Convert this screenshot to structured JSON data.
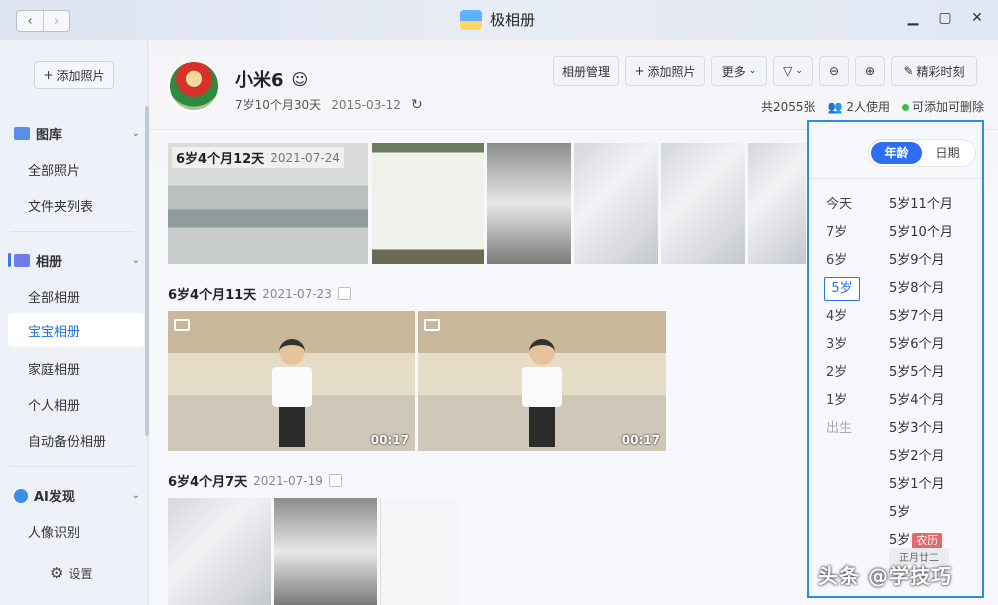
{
  "titlebar": {
    "app_name": "极相册",
    "back_icon": "chevron-left-icon",
    "forward_icon": "chevron-right-icon"
  },
  "sidebar": {
    "add_photo": "添加照片",
    "sections": [
      {
        "title": "图库",
        "items": [
          "全部照片",
          "文件夹列表"
        ]
      },
      {
        "title": "相册",
        "items": [
          "全部相册",
          "宝宝相册",
          "家庭相册",
          "个人相册",
          "自动备份相册"
        ]
      },
      {
        "title": "AI发现",
        "items": [
          "人像识别"
        ]
      }
    ],
    "active_item": "宝宝相册",
    "settings": "设置"
  },
  "profile": {
    "name": "小米6",
    "age": "7岁10个月30天",
    "birth_date": "2015-03-12"
  },
  "toolbar": {
    "album_manage": "相册管理",
    "add_photo": "添加照片",
    "more": "更多",
    "highlights": "精彩时刻"
  },
  "stats": {
    "total": "共2055张",
    "users": "2人使用",
    "deletable": "可添加可删除"
  },
  "groups": [
    {
      "age": "6岁4个月12天",
      "date": "2021-07-24"
    },
    {
      "age": "6岁4个月11天",
      "date": "2021-07-23"
    },
    {
      "age": "6岁4个月7天",
      "date": "2021-07-19"
    }
  ],
  "videos": [
    {
      "duration": "00:17"
    },
    {
      "duration": "00:17"
    }
  ],
  "timeline": {
    "tab_age": "年龄",
    "tab_date": "日期",
    "years": [
      "今天",
      "7岁",
      "6岁",
      "5岁",
      "4岁",
      "3岁",
      "2岁",
      "1岁",
      "出生"
    ],
    "selected_year": "5岁",
    "months": [
      "5岁11个月",
      "5岁10个月",
      "5岁9个月",
      "5岁8个月",
      "5岁7个月",
      "5岁6个月",
      "5岁5个月",
      "5岁4个月",
      "5岁3个月",
      "5岁2个月",
      "5岁1个月",
      "5岁",
      "5岁"
    ],
    "lunar_badge": "农历",
    "lunar_date": "正月廿二"
  },
  "watermark": "头条 @学技巧"
}
